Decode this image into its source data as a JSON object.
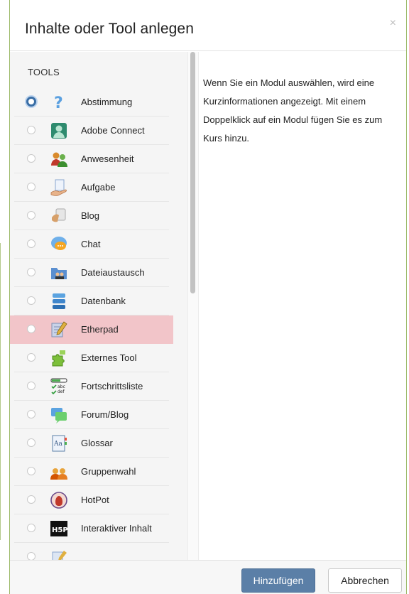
{
  "dialog": {
    "title": "Inhalte oder Tool anlegen",
    "close_glyph": "×"
  },
  "tools": {
    "heading": "TOOLS",
    "items": [
      {
        "label": "Abstimmung",
        "icon": "question-icon"
      },
      {
        "label": "Adobe Connect",
        "icon": "person-icon"
      },
      {
        "label": "Anwesenheit",
        "icon": "group-icon"
      },
      {
        "label": "Aufgabe",
        "icon": "assignment-hand-icon"
      },
      {
        "label": "Blog",
        "icon": "blog-icon"
      },
      {
        "label": "Chat",
        "icon": "chat-bubble-icon"
      },
      {
        "label": "Dateiaustausch",
        "icon": "folder-people-icon"
      },
      {
        "label": "Datenbank",
        "icon": "database-icon"
      },
      {
        "label": "Etherpad",
        "icon": "pad-pencil-icon"
      },
      {
        "label": "Externes Tool",
        "icon": "puzzle-icon"
      },
      {
        "label": "Fortschrittsliste",
        "icon": "checklist-icon"
      },
      {
        "label": "Forum/Blog",
        "icon": "forum-icon"
      },
      {
        "label": "Glossar",
        "icon": "glossary-book-icon"
      },
      {
        "label": "Gruppenwahl",
        "icon": "group-choice-icon"
      },
      {
        "label": "HotPot",
        "icon": "hotpot-icon"
      },
      {
        "label": "Interaktiver Inhalt",
        "icon": "h5p-icon"
      },
      {
        "label": "",
        "icon": "page-pencil-icon"
      }
    ],
    "focused_index": 0,
    "highlighted_index": 8
  },
  "description": {
    "text": "Wenn Sie ein Modul auswählen, wird eine Kurzinformationen angezeigt. Mit einem Doppelklick auf ein Modul fügen Sie es zum Kurs hinzu."
  },
  "footer": {
    "add_label": "Hinzufügen",
    "cancel_label": "Abbrechen"
  },
  "colors": {
    "accent": "#5b7fa7",
    "highlight": "#f2c5c9",
    "frame": "#9dbb6a"
  },
  "h5p_text": "H5P",
  "checklist_text": "abc def"
}
